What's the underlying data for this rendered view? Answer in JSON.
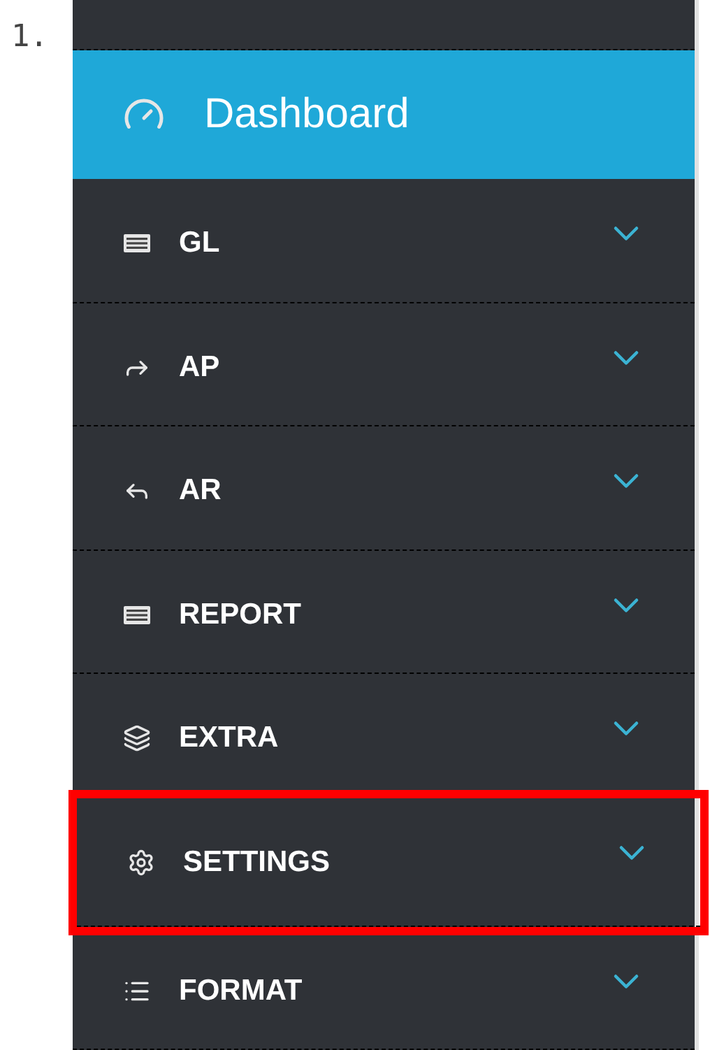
{
  "list_marker": "1.",
  "sidebar": {
    "items": [
      {
        "label": "Dashboard",
        "selected": true,
        "highlighted": false
      },
      {
        "label": "GL",
        "selected": false,
        "highlighted": false
      },
      {
        "label": "AP",
        "selected": false,
        "highlighted": false
      },
      {
        "label": "AR",
        "selected": false,
        "highlighted": false
      },
      {
        "label": "REPORT",
        "selected": false,
        "highlighted": false
      },
      {
        "label": "EXTRA",
        "selected": false,
        "highlighted": false
      },
      {
        "label": "SETTINGS",
        "selected": false,
        "highlighted": true
      },
      {
        "label": "FORMAT",
        "selected": false,
        "highlighted": false
      }
    ]
  }
}
